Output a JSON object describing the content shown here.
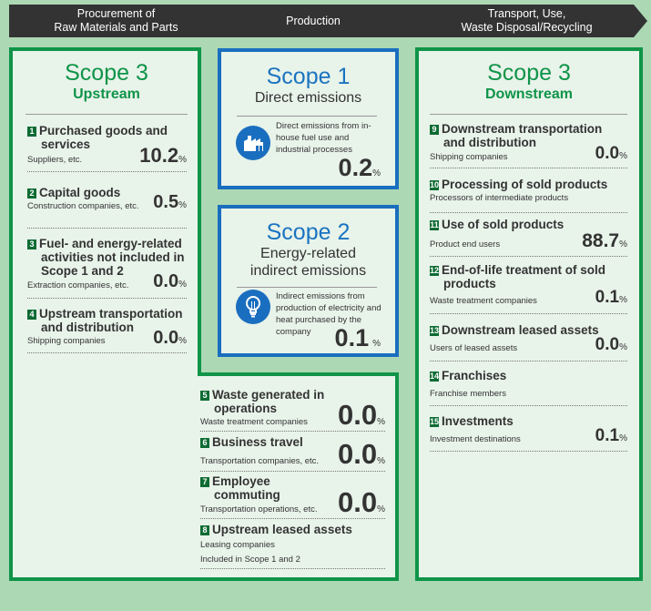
{
  "stages": [
    {
      "label": "Procurement of\nRaw Materials and Parts"
    },
    {
      "label": "Production"
    },
    {
      "label": "Transport, Use,\nWaste Disposal/Recycling"
    }
  ],
  "upstream": {
    "title": "Scope 3",
    "subtitle": "Upstream",
    "items": [
      {
        "num": "1",
        "line1": "Purchased goods and",
        "line2": "services",
        "sub": "Suppliers, etc.",
        "value": "10.2",
        "unit": "%"
      },
      {
        "num": "2",
        "line1": "Capital goods",
        "sub": "Construction companies, etc.",
        "value": "0.5",
        "unit": "%"
      },
      {
        "num": "3",
        "line1": "Fuel- and energy-related",
        "line2": "activities not included in",
        "line3": "Scope 1 and 2",
        "sub": "Extraction companies, etc.",
        "value": "0.0",
        "unit": "%"
      },
      {
        "num": "4",
        "line1": "Upstream transportation",
        "line2": "and distribution",
        "sub": "Shipping companies",
        "value": "0.0",
        "unit": "%"
      },
      {
        "num": "5",
        "line1": "Waste generated in",
        "line2": "operations",
        "sub": "Waste treatment companies",
        "value": "0.0",
        "unit": "%"
      },
      {
        "num": "6",
        "line1": "Business travel",
        "sub": "Transportation companies, etc.",
        "value": "0.0",
        "unit": "%"
      },
      {
        "num": "7",
        "line1": "Employee",
        "line2": "commuting",
        "sub": "Transportation operations, etc.",
        "value": "0.0",
        "unit": "%"
      },
      {
        "num": "8",
        "line1": "Upstream leased assets",
        "sub": "Leasing companies",
        "sub2": "Included in Scope 1 and 2"
      }
    ]
  },
  "scope1": {
    "title": "Scope 1",
    "subtitle": "Direct emissions",
    "icon": "factory-icon",
    "description": "Direct emissions from in-house fuel use and industrial processes",
    "value": "0.2",
    "unit": "%"
  },
  "scope2": {
    "title": "Scope 2",
    "subtitle_line1": "Energy-related",
    "subtitle_line2": "indirect emissions",
    "icon": "lightbulb-icon",
    "description": "Indirect emissions from production of electricity and heat purchased by the company",
    "value": "0.1",
    "unit": "%"
  },
  "downstream": {
    "title": "Scope 3",
    "subtitle": "Downstream",
    "items": [
      {
        "num": "9",
        "line1": "Downstream transportation",
        "line2": "and distribution",
        "sub": "Shipping companies",
        "value": "0.0",
        "unit": "%"
      },
      {
        "num": "10",
        "line1": "Processing of sold products",
        "sub": "Processors of intermediate products"
      },
      {
        "num": "11",
        "line1": "Use of sold products",
        "sub": "Product end users",
        "value": "88.7",
        "unit": "%"
      },
      {
        "num": "12",
        "line1": "End-of-life treatment of sold",
        "line2": "products",
        "sub": "Waste treatment companies",
        "value": "0.1",
        "unit": "%"
      },
      {
        "num": "13",
        "line1": "Downstream leased assets",
        "sub": "Users of leased assets",
        "value": "0.0",
        "unit": "%"
      },
      {
        "num": "14",
        "line1": "Franchises",
        "sub": "Franchise members"
      },
      {
        "num": "15",
        "line1": "Investments",
        "sub": "Investment destinations",
        "value": "0.1",
        "unit": "%"
      }
    ]
  },
  "colors": {
    "scope3": "#0f9448",
    "scope12": "#1a6ebf",
    "header": "#333333",
    "background": "#acd8b4"
  }
}
